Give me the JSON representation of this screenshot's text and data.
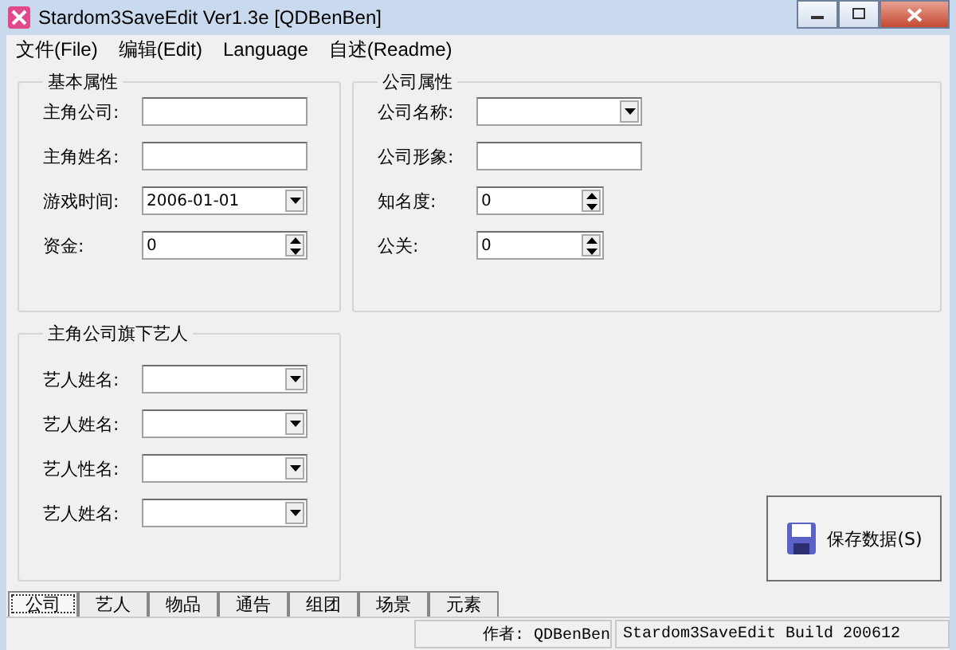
{
  "window": {
    "title": "Stardom3SaveEdit Ver1.3e [QDBenBen]"
  },
  "menu": [
    "文件(File)",
    "编辑(Edit)",
    "Language",
    "自述(Readme)"
  ],
  "basic": {
    "title": "基本属性",
    "fields": [
      {
        "kind": "text",
        "label": "主角公司:"
      },
      {
        "kind": "text",
        "label": "主角姓名:"
      },
      {
        "kind": "combo",
        "label": "游戏时间:",
        "value": "2006-01-01"
      },
      {
        "kind": "spin",
        "label": "资金:",
        "value": "0"
      }
    ]
  },
  "company": {
    "title": "公司属性",
    "fields": [
      {
        "kind": "combo",
        "label": "公司名称:"
      },
      {
        "kind": "text",
        "label": "公司形象:"
      },
      {
        "kind": "spin",
        "label": "知名度:",
        "value": "0"
      },
      {
        "kind": "spin",
        "label": "公关:",
        "value": "0"
      }
    ]
  },
  "artists": {
    "title": "主角公司旗下艺人",
    "fields": [
      {
        "kind": "combo",
        "label": "艺人姓名:"
      },
      {
        "kind": "combo",
        "label": "艺人姓名:"
      },
      {
        "kind": "combo",
        "label": "艺人性名:"
      },
      {
        "kind": "combo",
        "label": "艺人姓名:"
      }
    ]
  },
  "save_button": {
    "label": "保存数据(S)"
  },
  "tabs": [
    {
      "label": "公司",
      "selected": true
    },
    {
      "label": "艺人",
      "selected": false
    },
    {
      "label": "物品",
      "selected": false
    },
    {
      "label": "通告",
      "selected": false
    },
    {
      "label": "组团",
      "selected": false
    },
    {
      "label": "场景",
      "selected": false
    },
    {
      "label": "元素",
      "selected": false
    }
  ],
  "status_bar": [
    "作者: QDBenBen",
    "Stardom3SaveEdit Build 200612"
  ]
}
